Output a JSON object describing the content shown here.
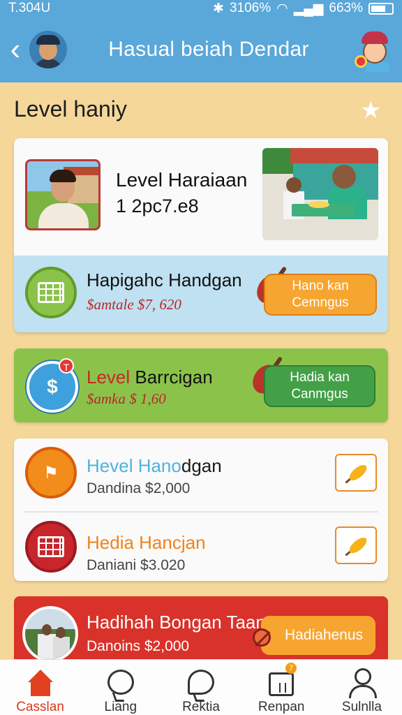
{
  "status": {
    "left_text": "T.304U",
    "right_text": "3106%",
    "battery_text": "663%"
  },
  "header": {
    "title": "Hasual beiah Dendar"
  },
  "section": {
    "title": "Level haniy"
  },
  "card1": {
    "title": "Level Haraiaan",
    "subtitle": "1 2pc7.e8",
    "band": {
      "title": "Hapigahc Handgan",
      "amount": "$amtale $7, 620",
      "button_label": "Hano kan Cemngus"
    }
  },
  "card2": {
    "title_red": "Level",
    "title_rest": " Barrcigan",
    "amount": "$amka $ 1,60",
    "button_label": "Hadia kan Canmgus",
    "badge": "T"
  },
  "card3": {
    "rows": [
      {
        "title_colored": "Hevel Hano",
        "title_rest": "dgan",
        "amount": "Dandina $2,000"
      },
      {
        "title_colored": "Hedia Hancjan",
        "title_rest": "",
        "amount": "Daniani $3.020"
      }
    ]
  },
  "card4": {
    "title": "Hadihah Bongan Taanus",
    "amount": "Danoins $2,000",
    "button_label": "Hadiahenus"
  },
  "nav": {
    "items": [
      {
        "label": "Casslan",
        "icon": "home-icon"
      },
      {
        "label": "Liang",
        "icon": "chat-icon"
      },
      {
        "label": "Rektia",
        "icon": "message-icon"
      },
      {
        "label": "Renpan",
        "icon": "calendar-icon",
        "badge": "7"
      },
      {
        "label": "Sulnlla",
        "icon": "user-icon"
      }
    ]
  },
  "colors": {
    "header_bg": "#5aa7d9",
    "page_bg": "#f5d79a",
    "active_nav": "#d63a1e"
  }
}
